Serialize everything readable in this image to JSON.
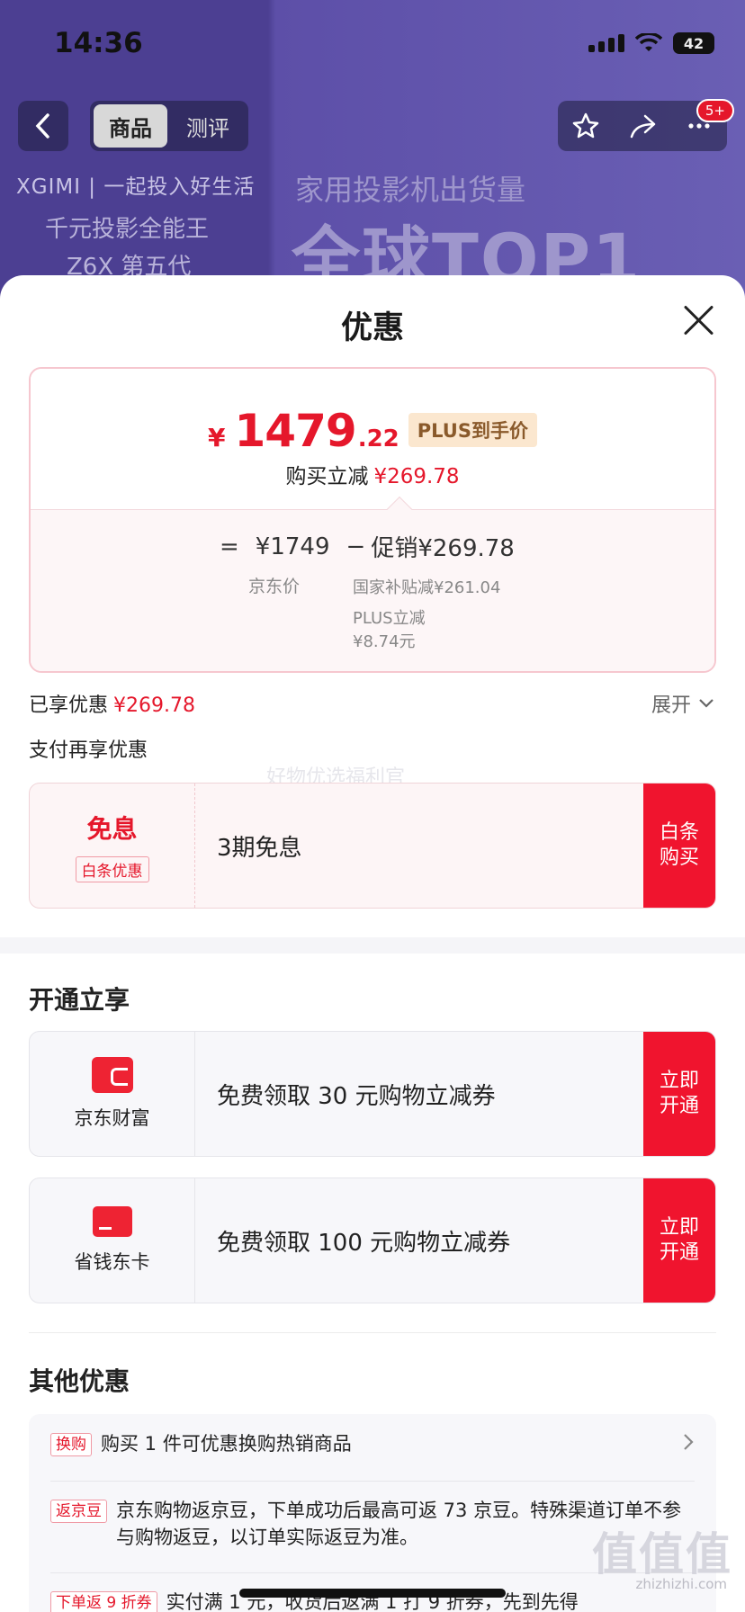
{
  "status_bar": {
    "time": "14:36",
    "battery": "42"
  },
  "nav": {
    "tabs": [
      "商品",
      "测评"
    ],
    "badge": "5+"
  },
  "background": {
    "brand": "XGIMI | 一起投入好生活",
    "sub1": "千元投影全能王",
    "sub2": "Z6X 第五代",
    "head1": "家用投影机出货量",
    "head2": "全球TOP1"
  },
  "sheet": {
    "title": "优惠",
    "price": {
      "yen": "¥",
      "integer": "1479",
      "decimal": ".22",
      "tag": "PLUS到手价",
      "reduce_label": "购买立减",
      "reduce_value": "¥269.78",
      "eq": "=",
      "jd_price": "¥1749",
      "minus": "−",
      "promo": "促销¥269.78",
      "jd_label": "京东价",
      "gov_label": "国家补贴减¥261.04",
      "plus_label": "PLUS立减",
      "plus_value": "¥8.74元"
    },
    "enjoyed_label": "已享优惠",
    "enjoyed_value": "¥269.78",
    "expand": "展开",
    "pay_more": "支付再享优惠",
    "watermark": "好物优选福利官",
    "baitiao": {
      "title": "免息",
      "tag": "白条优惠",
      "desc": "3期免息",
      "button": "白条购买"
    },
    "open_section": "开通立享",
    "jd_finance": {
      "name": "京东财富",
      "desc": "免费领取 30 元购物立减券",
      "button": "立即开通"
    },
    "saver_card": {
      "name": "省钱东卡",
      "desc": "免费领取 100 元购物立减券",
      "button": "立即开通"
    },
    "other_section": "其他优惠",
    "other": [
      {
        "tag": "换购",
        "text": "购买 1 件可优惠换购热销商品"
      },
      {
        "tag": "返京豆",
        "text": "京东购物返京豆，下单成功后最高可返 73 京豆。特殊渠道订单不参与购物返豆，以订单实际返豆为准。"
      },
      {
        "tag": "下单返 9 折券",
        "text": "实付满 1 元，收货后返满 1 打 9 折券，先到先得"
      }
    ],
    "site_watermark": "值值值",
    "site_url": "zhizhizhi.com"
  }
}
